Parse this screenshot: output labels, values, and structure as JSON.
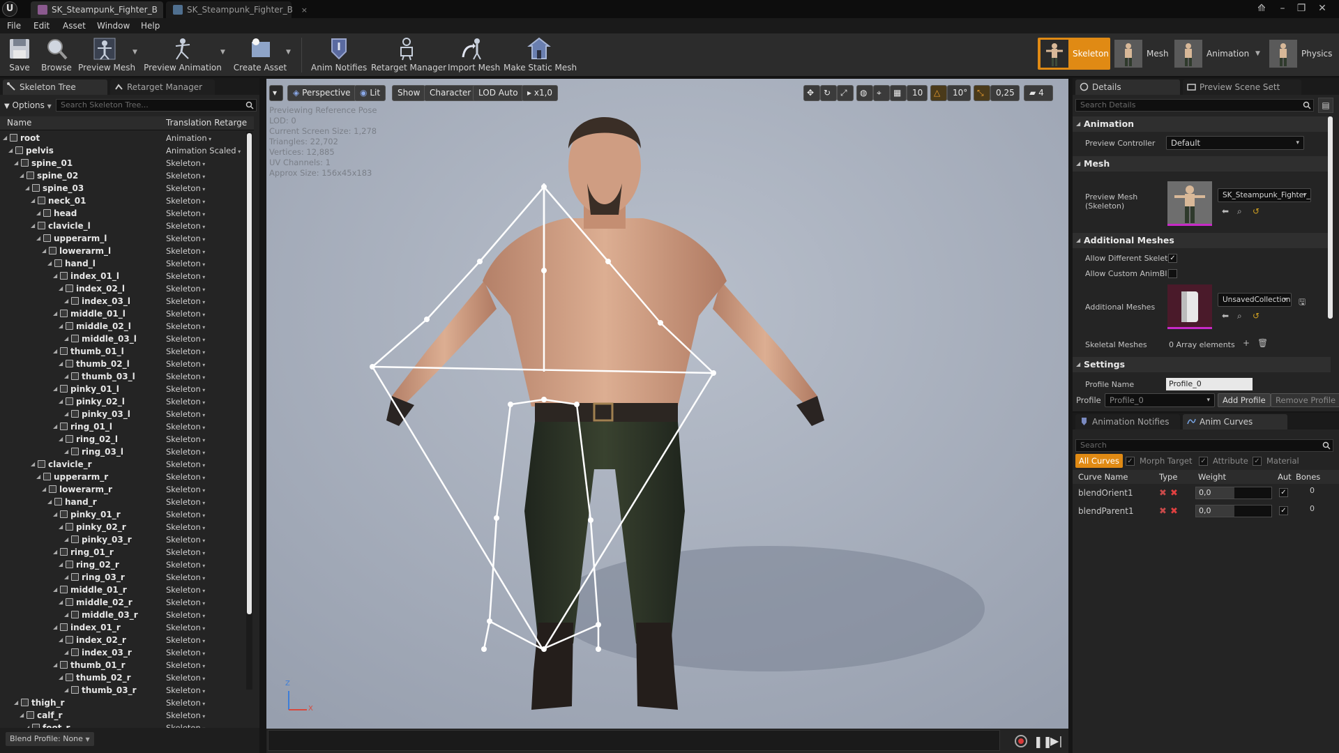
{
  "titlebar": {
    "tabs": [
      {
        "label": "SK_Steampunk_Fighter_B",
        "close": "×"
      },
      {
        "label": "SK_Steampunk_Fighter_B",
        "close": "×"
      }
    ],
    "logo": "U"
  },
  "menu": [
    "File",
    "Edit",
    "Asset",
    "Window",
    "Help"
  ],
  "toolbar": {
    "buttons": [
      "Save",
      "Browse",
      "Preview Mesh",
      "Preview Animation",
      "Create Asset",
      "Anim Notifies",
      "Retarget Manager",
      "Import Mesh",
      "Make Static Mesh"
    ],
    "modes": [
      "Skeleton",
      "Mesh",
      "Animation",
      "Physics"
    ]
  },
  "skeleton_panel": {
    "tabs": [
      "Skeleton Tree",
      "Retarget Manager"
    ],
    "options_label": "Options",
    "search_placeholder": "Search Skeleton Tree...",
    "col_name": "Name",
    "col_retarget": "Translation Retarge",
    "rows": [
      {
        "name": "root",
        "retarget": "Animation",
        "depth": 0
      },
      {
        "name": "pelvis",
        "retarget": "Animation Scaled",
        "depth": 1
      },
      {
        "name": "spine_01",
        "retarget": "Skeleton",
        "depth": 2
      },
      {
        "name": "spine_02",
        "retarget": "Skeleton",
        "depth": 3
      },
      {
        "name": "spine_03",
        "retarget": "Skeleton",
        "depth": 4
      },
      {
        "name": "neck_01",
        "retarget": "Skeleton",
        "depth": 5
      },
      {
        "name": "head",
        "retarget": "Skeleton",
        "depth": 6
      },
      {
        "name": "clavicle_l",
        "retarget": "Skeleton",
        "depth": 5
      },
      {
        "name": "upperarm_l",
        "retarget": "Skeleton",
        "depth": 6
      },
      {
        "name": "lowerarm_l",
        "retarget": "Skeleton",
        "depth": 7
      },
      {
        "name": "hand_l",
        "retarget": "Skeleton",
        "depth": 8
      },
      {
        "name": "index_01_l",
        "retarget": "Skeleton",
        "depth": 9
      },
      {
        "name": "index_02_l",
        "retarget": "Skeleton",
        "depth": 10
      },
      {
        "name": "index_03_l",
        "retarget": "Skeleton",
        "depth": 11
      },
      {
        "name": "middle_01_l",
        "retarget": "Skeleton",
        "depth": 9
      },
      {
        "name": "middle_02_l",
        "retarget": "Skeleton",
        "depth": 10
      },
      {
        "name": "middle_03_l",
        "retarget": "Skeleton",
        "depth": 11
      },
      {
        "name": "thumb_01_l",
        "retarget": "Skeleton",
        "depth": 9
      },
      {
        "name": "thumb_02_l",
        "retarget": "Skeleton",
        "depth": 10
      },
      {
        "name": "thumb_03_l",
        "retarget": "Skeleton",
        "depth": 11
      },
      {
        "name": "pinky_01_l",
        "retarget": "Skeleton",
        "depth": 9
      },
      {
        "name": "pinky_02_l",
        "retarget": "Skeleton",
        "depth": 10
      },
      {
        "name": "pinky_03_l",
        "retarget": "Skeleton",
        "depth": 11
      },
      {
        "name": "ring_01_l",
        "retarget": "Skeleton",
        "depth": 9
      },
      {
        "name": "ring_02_l",
        "retarget": "Skeleton",
        "depth": 10
      },
      {
        "name": "ring_03_l",
        "retarget": "Skeleton",
        "depth": 11
      },
      {
        "name": "clavicle_r",
        "retarget": "Skeleton",
        "depth": 5
      },
      {
        "name": "upperarm_r",
        "retarget": "Skeleton",
        "depth": 6
      },
      {
        "name": "lowerarm_r",
        "retarget": "Skeleton",
        "depth": 7
      },
      {
        "name": "hand_r",
        "retarget": "Skeleton",
        "depth": 8
      },
      {
        "name": "pinky_01_r",
        "retarget": "Skeleton",
        "depth": 9
      },
      {
        "name": "pinky_02_r",
        "retarget": "Skeleton",
        "depth": 10
      },
      {
        "name": "pinky_03_r",
        "retarget": "Skeleton",
        "depth": 11
      },
      {
        "name": "ring_01_r",
        "retarget": "Skeleton",
        "depth": 9
      },
      {
        "name": "ring_02_r",
        "retarget": "Skeleton",
        "depth": 10
      },
      {
        "name": "ring_03_r",
        "retarget": "Skeleton",
        "depth": 11
      },
      {
        "name": "middle_01_r",
        "retarget": "Skeleton",
        "depth": 9
      },
      {
        "name": "middle_02_r",
        "retarget": "Skeleton",
        "depth": 10
      },
      {
        "name": "middle_03_r",
        "retarget": "Skeleton",
        "depth": 11
      },
      {
        "name": "index_01_r",
        "retarget": "Skeleton",
        "depth": 9
      },
      {
        "name": "index_02_r",
        "retarget": "Skeleton",
        "depth": 10
      },
      {
        "name": "index_03_r",
        "retarget": "Skeleton",
        "depth": 11
      },
      {
        "name": "thumb_01_r",
        "retarget": "Skeleton",
        "depth": 9
      },
      {
        "name": "thumb_02_r",
        "retarget": "Skeleton",
        "depth": 10
      },
      {
        "name": "thumb_03_r",
        "retarget": "Skeleton",
        "depth": 11
      },
      {
        "name": "thigh_r",
        "retarget": "Skeleton",
        "depth": 2
      },
      {
        "name": "calf_r",
        "retarget": "Skeleton",
        "depth": 3
      },
      {
        "name": "foot_r",
        "retarget": "Skeleton",
        "depth": 4
      }
    ],
    "blend_profile": "Blend Profile: None"
  },
  "viewport": {
    "perspective": "Perspective",
    "lit": "Lit",
    "show": "Show",
    "character": "Character",
    "lod": "LOD Auto",
    "speed": "x1,0",
    "grid_snap": "10",
    "rot_snap": "10°",
    "scale_snap": "0,25",
    "cam_speed": "4",
    "stats": [
      "Previewing Reference Pose",
      "LOD: 0",
      "Current Screen Size: 1,278",
      "Triangles: 22,702",
      "Vertices: 12,885",
      "UV Channels: 1",
      "Approx Size: 156x45x183"
    ],
    "axis_z": "Z",
    "axis_x": "X"
  },
  "details": {
    "tabs": [
      "Details",
      "Preview Scene Sett"
    ],
    "search_placeholder": "Search Details",
    "animation_section": "Animation",
    "preview_controller_label": "Preview Controller",
    "preview_controller_value": "Default",
    "mesh_section": "Mesh",
    "preview_mesh_label": "Preview Mesh (Skeleton)",
    "preview_mesh_value": "SK_Steampunk_Fighter_",
    "additional_section": "Additional Meshes",
    "allow_diff_label": "Allow Different Skelet",
    "allow_custom_label": "Allow Custom AnimBl",
    "additional_meshes_label": "Additional Meshes",
    "additional_meshes_value": "UnsavedCollection",
    "skeletal_meshes_label": "Skeletal Meshes",
    "skeletal_meshes_value": "0 Array elements",
    "settings_section": "Settings",
    "profile_name_label": "Profile Name",
    "profile_name_value": "Profile_0",
    "profile_label": "Profile",
    "profile_value": "Profile_0",
    "add_profile": "Add Profile",
    "remove_profile": "Remove Profile"
  },
  "curves": {
    "tabs": [
      "Animation Notifies",
      "Anim Curves"
    ],
    "search_placeholder": "Search",
    "filters": [
      "All Curves",
      "Morph Target",
      "Attribute",
      "Material"
    ],
    "columns": [
      "Curve Name",
      "Type",
      "Weight",
      "Auto",
      "Bones"
    ],
    "rows": [
      {
        "name": "blendOrient1",
        "weight": "0,0",
        "bones": "0"
      },
      {
        "name": "blendParent1",
        "weight": "0,0",
        "bones": "0"
      }
    ]
  },
  "colors": {
    "accent_orange": "#e08a14",
    "viewport_bg": "#a4acbc",
    "bone_white": "#ffffff"
  }
}
